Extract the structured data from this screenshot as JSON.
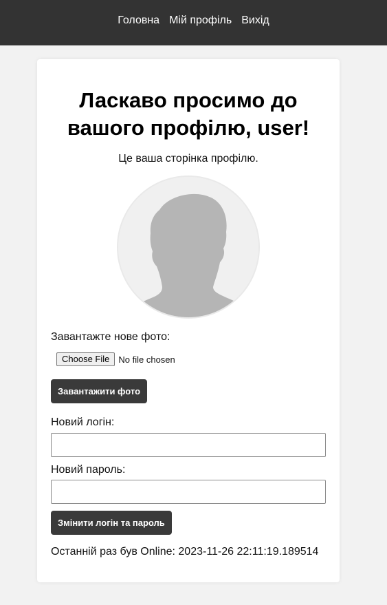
{
  "nav": {
    "items": [
      {
        "label": "Головна"
      },
      {
        "label": "Мій профіль"
      },
      {
        "label": "Вихід"
      }
    ]
  },
  "profile": {
    "title": "Ласкаво просимо до вашого профілю, user!",
    "subtitle": "Це ваша сторінка профілю.",
    "avatar_icon": "user-silhouette-icon"
  },
  "upload": {
    "label": "Завантажте нове фото:",
    "choose_file_label": "Choose File",
    "file_status": "No file chosen",
    "submit_label": "Завантажити фото"
  },
  "credentials": {
    "login_label": "Новий логін:",
    "login_value": "",
    "password_label": "Новий пароль:",
    "password_value": "",
    "submit_label": "Змінити логін та пароль"
  },
  "status": {
    "last_online": "Останній раз був Online: 2023-11-26 22:11:19.189514"
  },
  "colors": {
    "navbar_bg": "#333333",
    "page_bg": "#f2f2f2",
    "button_bg": "#3a3a3a",
    "avatar_bg": "#f0f0f0",
    "silhouette": "#b5b5b5"
  }
}
